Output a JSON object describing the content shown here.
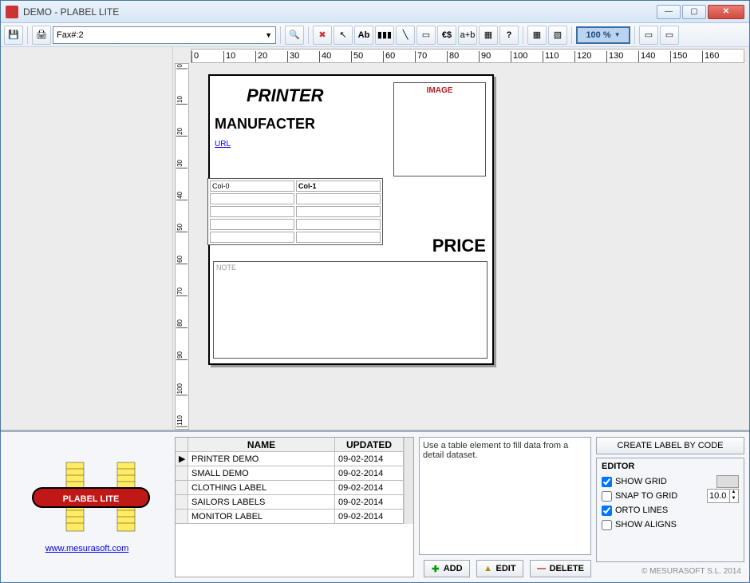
{
  "window": {
    "title": "DEMO - PLABEL LITE"
  },
  "toolbar": {
    "printer_combo": "Fax#:2",
    "zoom": "100 %",
    "icons": {
      "save": "💾",
      "print": "🖨",
      "preview": "🔍",
      "delete": "✖",
      "pointer": "↖",
      "text": "Ab",
      "barcode": "▮▮▮",
      "line": "╲",
      "rect": "▭",
      "currency": "€$",
      "expr": "a+b",
      "calendar": "▦",
      "help": "?",
      "grid": "▦",
      "image": "▧",
      "fit": "▭",
      "full": "▭"
    }
  },
  "ruler": {
    "steps": [
      "0",
      "10",
      "20",
      "30",
      "40",
      "50",
      "60",
      "70",
      "80",
      "90",
      "100",
      "110",
      "120",
      "130",
      "140",
      "150",
      "160"
    ],
    "vsteps": [
      "0",
      "10",
      "20",
      "30",
      "40",
      "50",
      "60",
      "70",
      "80",
      "90",
      "100",
      "110"
    ]
  },
  "label": {
    "title": "PRINTER",
    "manufacturer": "MANUFACTER",
    "url_label": "URL",
    "image_label": "IMAGE",
    "price": "PRICE",
    "note_label": "NOTE",
    "table_headers": [
      "Col-0",
      "Col-1"
    ]
  },
  "grid": {
    "headers": [
      "NAME",
      "UPDATED"
    ],
    "rows": [
      {
        "name": "PRINTER DEMO",
        "updated": "09-02-2014",
        "active": true
      },
      {
        "name": "SMALL DEMO",
        "updated": "09-02-2014"
      },
      {
        "name": "CLOTHING LABEL",
        "updated": "09-02-2014"
      },
      {
        "name": "SAILORS LABELS",
        "updated": "09-02-2014"
      },
      {
        "name": "MONITOR LABEL",
        "updated": "09-02-2014"
      }
    ]
  },
  "hint": "Use a table element to fill data from a detail dataset.",
  "actions": {
    "add": "ADD",
    "edit": "EDIT",
    "delete": "DELETE"
  },
  "right": {
    "create_button": "CREATE LABEL BY CODE",
    "editor_header": "EDITOR",
    "show_grid": "SHOW GRID",
    "snap": "SNAP TO GRID",
    "orto": "ORTO LINES",
    "aligns": "SHOW ALIGNS",
    "snap_value": "10.0"
  },
  "footer": {
    "url": "www.mesurasoft.com",
    "copyright": "© MESURASOFT  S.L. 2014"
  }
}
